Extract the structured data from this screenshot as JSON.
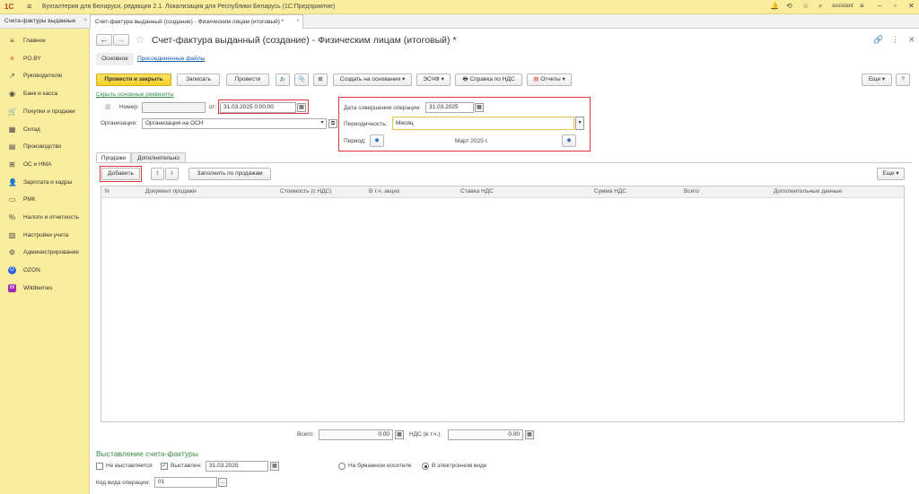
{
  "app": {
    "title": "Бухгалтерия для Беларуси, редакция 2.1. Локализация для Республики Беларусь   (1С:Предприятие)",
    "user": "assistant"
  },
  "tabs": [
    {
      "label": "Счета-фактуры выданные"
    },
    {
      "label": "Счет-фактура выданный (создание) - Физическим лицам (итоговый) *"
    }
  ],
  "sidebar": {
    "items": [
      {
        "label": "Главное",
        "icon": "≡"
      },
      {
        "label": "PO.BY",
        "icon": "✳"
      },
      {
        "label": "Руководителю",
        "icon": "↗"
      },
      {
        "label": "Банк и касса",
        "icon": "◉"
      },
      {
        "label": "Покупки и продажи",
        "icon": "🛒"
      },
      {
        "label": "Склад",
        "icon": "▦"
      },
      {
        "label": "Производство",
        "icon": "▤"
      },
      {
        "label": "ОС и НМА",
        "icon": "⊞"
      },
      {
        "label": "Зарплата и кадры",
        "icon": "👤"
      },
      {
        "label": "РМК",
        "icon": "▭"
      },
      {
        "label": "Налоги и отчетность",
        "icon": "%"
      },
      {
        "label": "Настройки учета",
        "icon": "▥"
      },
      {
        "label": "Администрирование",
        "icon": "⚙"
      },
      {
        "label": "OZON",
        "icon": "O"
      },
      {
        "label": "Wildberries",
        "icon": "W"
      }
    ]
  },
  "form": {
    "title": "Счет-фактура выданный (создание) - Физическим лицам (итоговый) *",
    "subtabs": [
      "Основное",
      "Присоединенные файлы"
    ],
    "toolbar": {
      "post_close": "Провести и закрыть",
      "save": "Записать",
      "post": "Провести",
      "create_based": "Создать на основании",
      "esf": "ЭСЧФ",
      "vat_ref": "Справка по НДС",
      "reports": "Отчеты",
      "more": "Еще",
      "help": "?"
    },
    "hide_link": "Скрыть основные реквизиты",
    "number_label": "Номер:",
    "number_value": "",
    "from_label": "от:",
    "date_value": "31.03.2025  0:00:00",
    "org_label": "Организация:",
    "org_value": "Организация на ОСН",
    "op_date_label": "Дата совершения операции:",
    "op_date_value": "31.03.2025",
    "period_label": "Периодичность:",
    "period_value": "Месяц",
    "periodp_label": "Период:",
    "periodp_value": "Март 2025 г.",
    "inner_tabs": [
      "Продажи",
      "Дополнительно"
    ],
    "add_btn": "Добавить",
    "fill_btn": "Заполнить по продажам",
    "table_more": "Еще",
    "columns": [
      "N",
      "Документ продажи",
      "Стоимость (с НДС)",
      "В т.ч. акциз",
      "Ставка НДС",
      "Сумма НДС",
      "Всего",
      "Дополнительные данные"
    ],
    "total_label": "Всего:",
    "total_value": "0.00",
    "vat_label": "НДС (в т.ч.):",
    "vat_value": "0.00",
    "issue_header": "Выставление счета-фактуры",
    "not_issued": "Не выставляется",
    "issued": "Выставлен:",
    "issued_date": "31.03.2025",
    "paper": "На бумажном носителе",
    "electronic": "В электронном виде",
    "op_code_label": "Код вида операции:",
    "op_code_value": "01"
  }
}
